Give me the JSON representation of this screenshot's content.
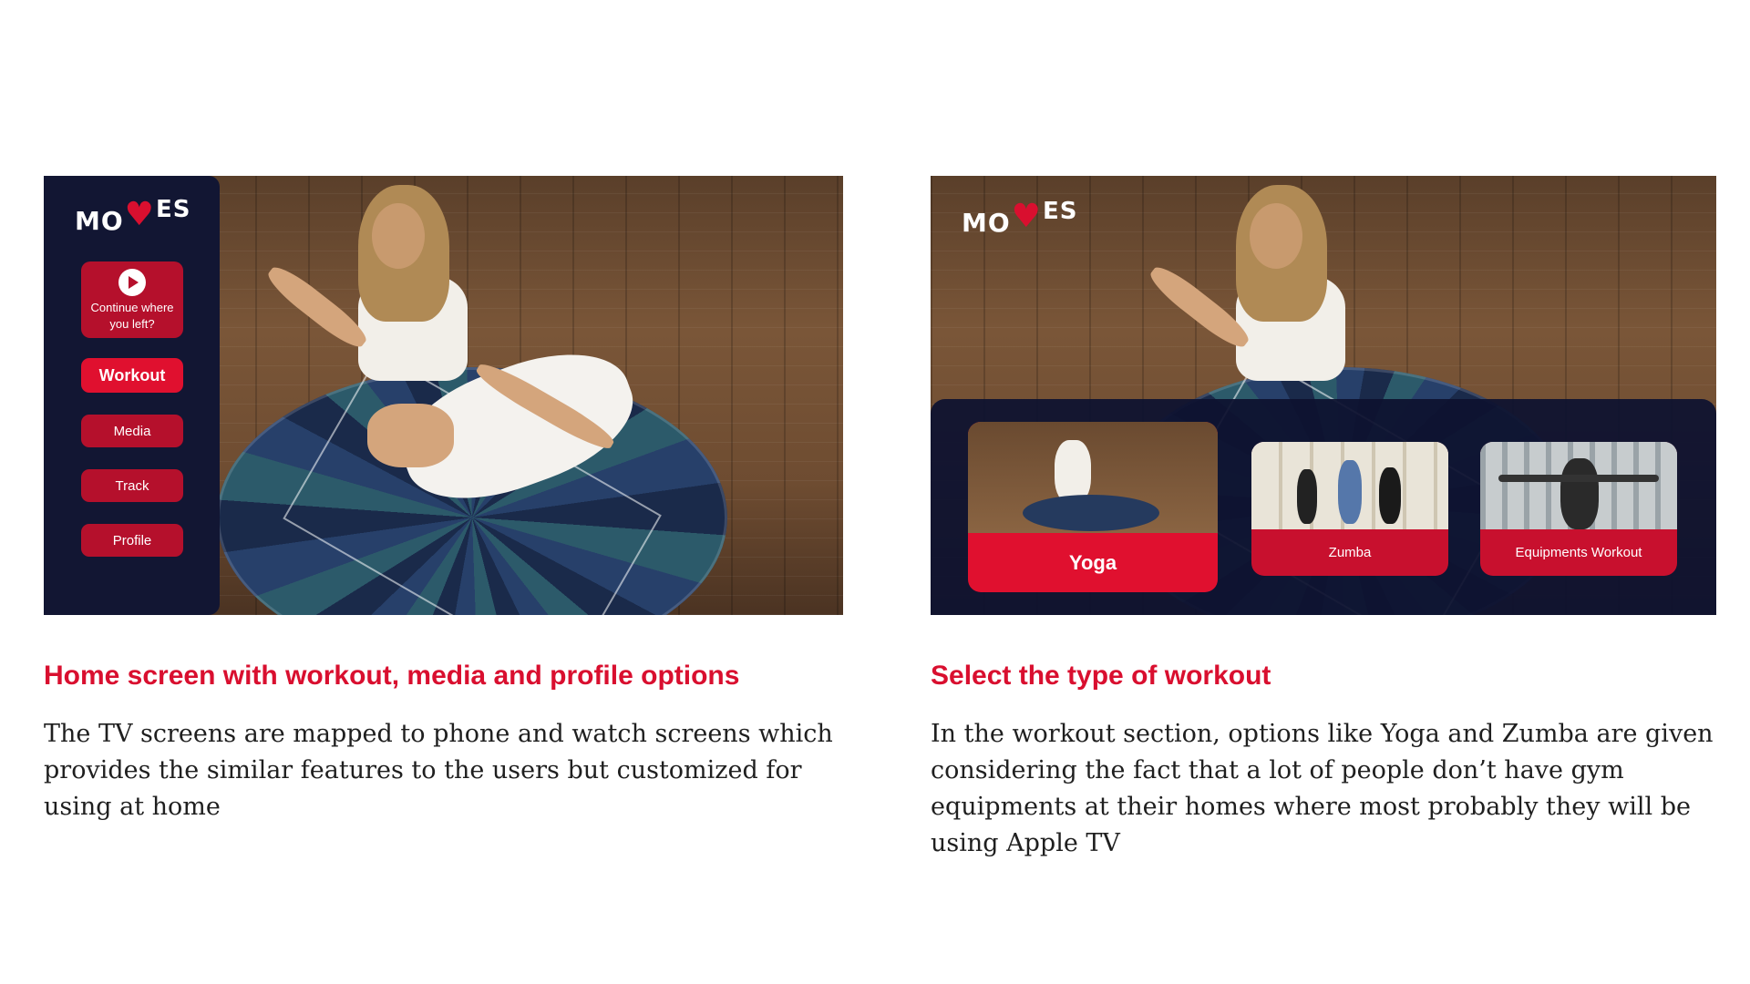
{
  "brand": {
    "logo_left": "MO",
    "logo_right": "ES",
    "accent": "#d90f2f",
    "dark": "#121633"
  },
  "home_screen": {
    "continue_label": "Continue where you left?",
    "continue_icon": "play-icon",
    "nav": [
      {
        "label": "Workout",
        "active": true
      },
      {
        "label": "Media",
        "active": false
      },
      {
        "label": "Track",
        "active": false
      },
      {
        "label": "Profile",
        "active": false
      }
    ]
  },
  "workout_screen": {
    "cards": [
      {
        "label": "Yoga",
        "selected": true
      },
      {
        "label": "Zumba",
        "selected": false
      },
      {
        "label": "Equipments Workout",
        "selected": false
      }
    ]
  },
  "captions": {
    "left": {
      "title": "Home screen with workout, media and profile options",
      "body": "The TV screens are mapped to phone and watch screens which provides the similar features to the users but customized for using at home"
    },
    "right": {
      "title": "Select the type of workout",
      "body": "In the workout section, options like Yoga and Zumba are given considering the fact that a lot of people don’t have gym equipments at their homes where most probably they will be using Apple TV"
    }
  }
}
